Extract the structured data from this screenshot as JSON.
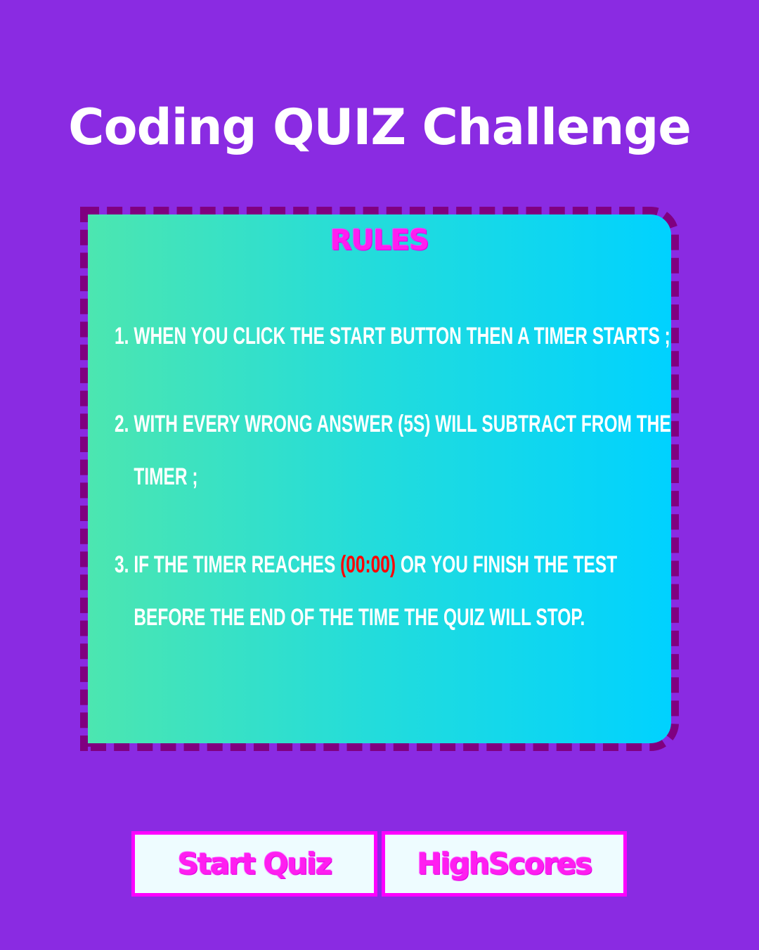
{
  "title": "Coding QUIZ Challenge",
  "rules": {
    "heading": "RULES",
    "items": [
      {
        "number": "1.",
        "text": "When you click the start button then a timer starts ;"
      },
      {
        "number": "2.",
        "text": "With every wrong answer (5s) will subtract from the timer ;"
      },
      {
        "number": "3.",
        "text_before": "If the timer reaches ",
        "highlight": "(00:00)",
        "text_after": " or you finish the test before the end of the time the quiz will stop."
      }
    ]
  },
  "buttons": {
    "start": "Start Quiz",
    "highscores": "HighScores"
  },
  "colors": {
    "background": "#8a2be2",
    "card_border": "#800080",
    "accent_pink": "#ff1ef0",
    "timer_highlight": "#ff0000"
  }
}
